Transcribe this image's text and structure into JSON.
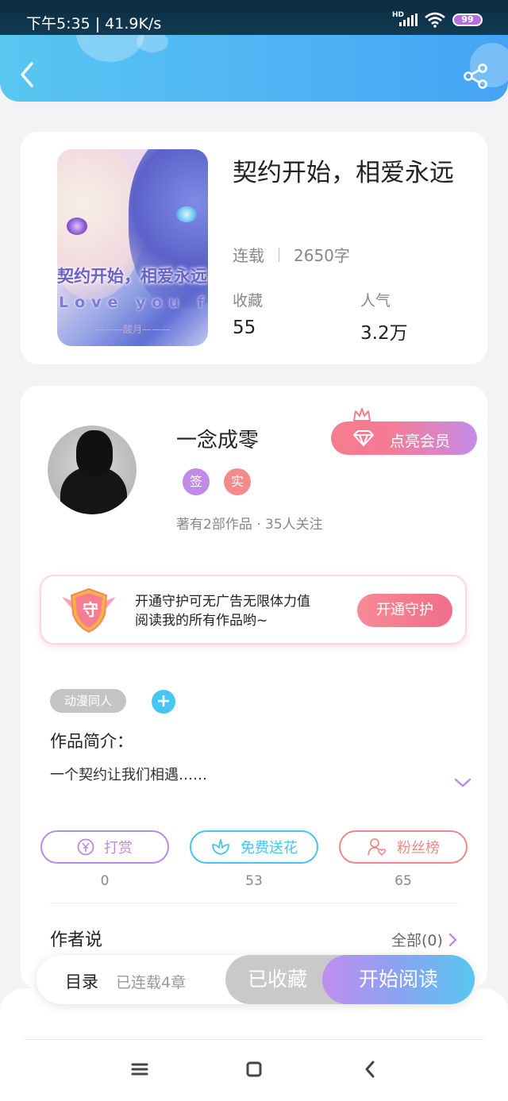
{
  "status_bar": {
    "time": "下午5:35 | 41.9K/s",
    "network": "HD",
    "battery": "99"
  },
  "header": {
    "back_icon": "chevron-left-icon",
    "share_icon": "share-icon"
  },
  "book": {
    "cover_title": "契约开始，相爱永远",
    "cover_subtitle": "Love you fo",
    "cover_author": "酸月",
    "title": "契约开始，相爱永远",
    "status": "连载",
    "word_count": "2650字",
    "stats": [
      {
        "label": "收藏",
        "value": "55"
      },
      {
        "label": "人气",
        "value": "3.2万"
      }
    ]
  },
  "author": {
    "name": "一念成零",
    "badges": [
      {
        "text": "签",
        "color": "#c08ae6"
      },
      {
        "text": "实",
        "color": "#f48a8a"
      }
    ],
    "stats_text": "著有2部作品 · 35人关注",
    "vip_button": "点亮会员"
  },
  "guard": {
    "icon_text": "守",
    "text_line1": "开通守护可无广告无限体力值",
    "text_line2": "阅读我的所有作品哟~",
    "button": "开通守护"
  },
  "tags": {
    "items": [
      "动漫同人"
    ],
    "add_label": "+"
  },
  "intro": {
    "label": "作品简介：",
    "text": "一个契约让我们相遇……"
  },
  "actions": [
    {
      "label": "打赏",
      "count": "0",
      "color": "#b98be3",
      "icon": "yen-icon"
    },
    {
      "label": "免费送花",
      "count": "53",
      "color": "#45c4ee",
      "icon": "flower-icon"
    },
    {
      "label": "粉丝榜",
      "count": "65",
      "color": "#ec8a8a",
      "icon": "fan-user-icon"
    }
  ],
  "author_says": {
    "label": "作者说",
    "all_link": "全部(0)"
  },
  "bottom_bar": {
    "toc": "目录",
    "toc_sub": "已连载4章",
    "collected": "已收藏",
    "start_reading": "开始阅读"
  },
  "colors": {
    "accent_blue": "#4fb4f4",
    "pink": "#f57c8e",
    "purple": "#c08ff0"
  }
}
